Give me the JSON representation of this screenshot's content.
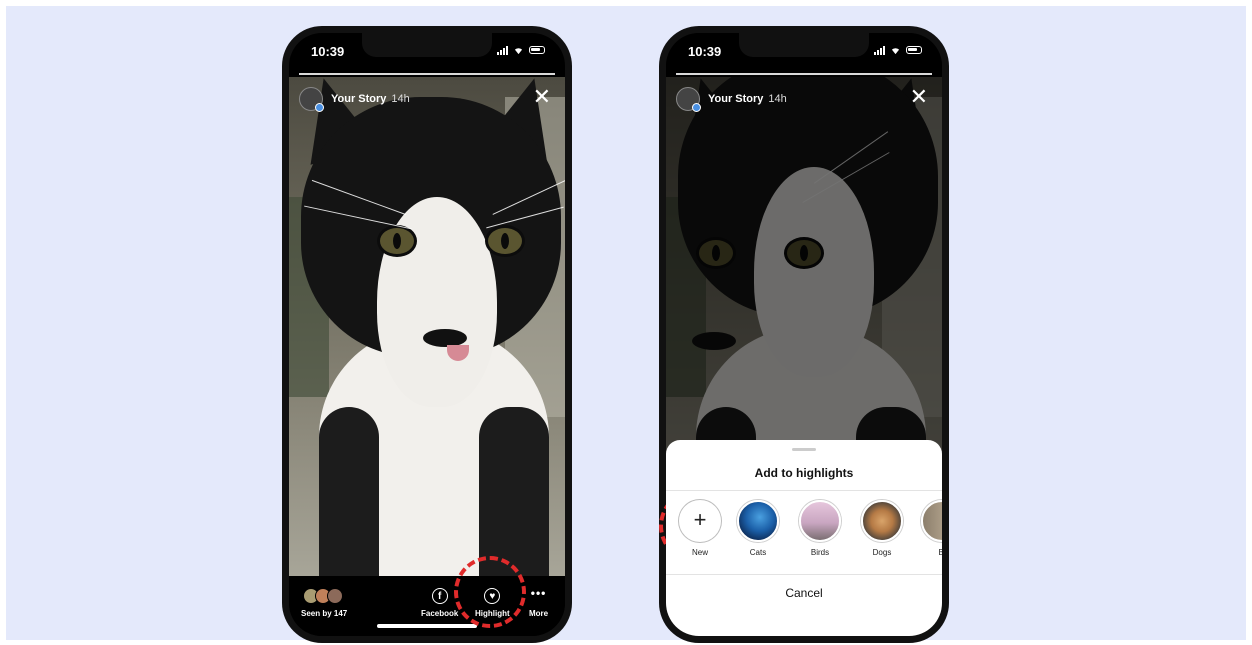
{
  "status_bar": {
    "time": "10:39"
  },
  "story": {
    "owner": "Your Story",
    "age": "14h"
  },
  "actions": {
    "seen_by": "Seen by 147",
    "facebook": "Facebook",
    "highlight": "Highlight",
    "more": "More"
  },
  "highlights_sheet": {
    "title": "Add to highlights",
    "items": [
      {
        "label": "New"
      },
      {
        "label": "Cats"
      },
      {
        "label": "Birds"
      },
      {
        "label": "Dogs"
      },
      {
        "label": "Bi"
      }
    ],
    "cancel": "Cancel"
  },
  "colors": {
    "annotation": "#e02b2b",
    "background": "#e4e9fb",
    "avatar_dot": "#4a90e2"
  },
  "icons": [
    "close-icon",
    "facebook-icon",
    "highlight-heart-icon",
    "more-dots-icon",
    "plus-icon"
  ]
}
